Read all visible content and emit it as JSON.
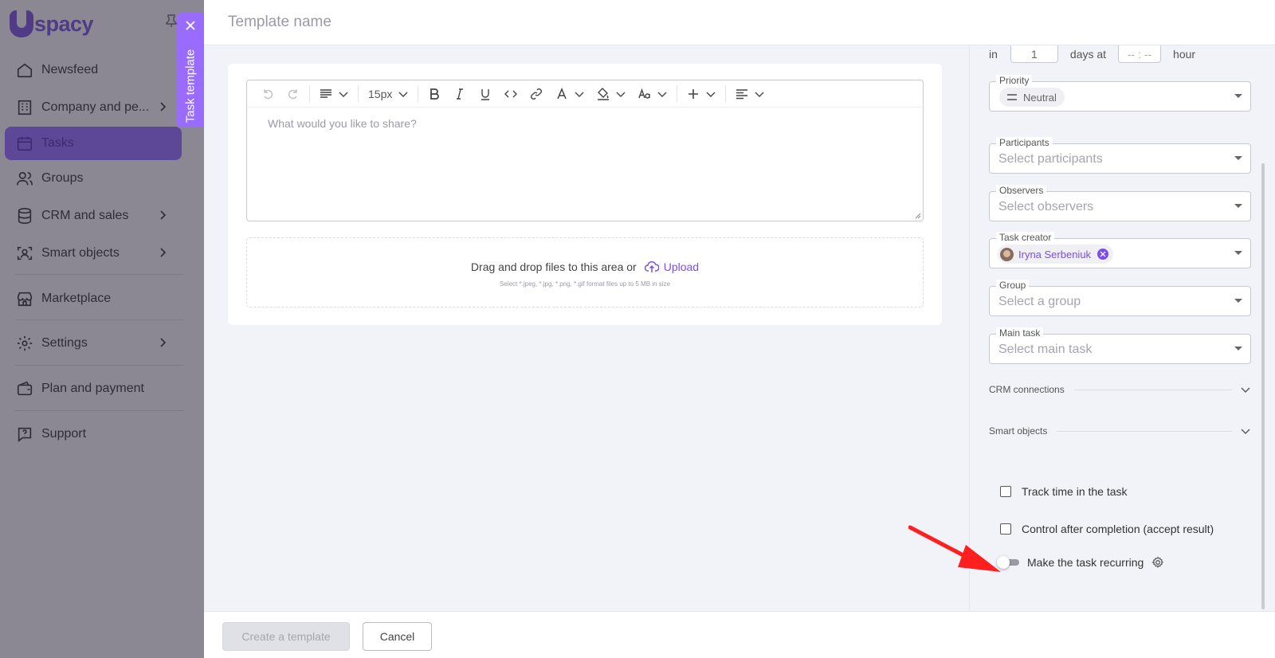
{
  "sidebar": {
    "logo_text": "spacy",
    "items": [
      {
        "label": "Newsfeed",
        "icon": "home-icon"
      },
      {
        "label": "Company and pe...",
        "icon": "building-icon"
      },
      {
        "label": "Tasks",
        "icon": "calendar-icon"
      },
      {
        "label": "Groups",
        "icon": "users-icon"
      },
      {
        "label": "CRM and sales",
        "icon": "database-icon"
      },
      {
        "label": "Smart objects",
        "icon": "smart-objects-icon"
      },
      {
        "label": "Marketplace",
        "icon": "store-icon"
      },
      {
        "label": "Settings",
        "icon": "gear-icon"
      },
      {
        "label": "Plan and payment",
        "icon": "wallet-icon"
      },
      {
        "label": "Support",
        "icon": "help-icon"
      }
    ]
  },
  "vertical_tab": {
    "label": "Task template"
  },
  "header": {
    "template_name_placeholder": "Template name"
  },
  "editor": {
    "font_size": "15px",
    "placeholder": "What would you like to share?"
  },
  "dropzone": {
    "text": "Drag and drop files to this area or",
    "upload_label": "Upload",
    "hint": "Select *.jpeg, *.jpg, *.png, *.gif format files up to 5 MB in size"
  },
  "deadline": {
    "in_label": "in",
    "days_value": "1",
    "days_at_label": "days at",
    "time_placeholder": "-- : --",
    "hour_label": "hour"
  },
  "fields": {
    "priority": {
      "label": "Priority",
      "value": "Neutral"
    },
    "participants": {
      "label": "Participants",
      "placeholder": "Select participants"
    },
    "observers": {
      "label": "Observers",
      "placeholder": "Select observers"
    },
    "task_creator": {
      "label": "Task creator",
      "value": "Iryna Serbeniuk"
    },
    "group": {
      "label": "Group",
      "placeholder": "Select a group"
    },
    "main_task": {
      "label": "Main task",
      "placeholder": "Select main task"
    }
  },
  "sections": {
    "crm": "CRM connections",
    "smart_objects": "Smart objects"
  },
  "options": {
    "track_time": "Track time in the task",
    "control_after": "Control after completion (accept result)",
    "recurring": "Make the task recurring"
  },
  "footer": {
    "create_label": "Create a template",
    "cancel_label": "Cancel"
  },
  "colors": {
    "accent": "#7b4cf0",
    "tab": "#9a6bff",
    "arrow": "#ff1f1f"
  }
}
